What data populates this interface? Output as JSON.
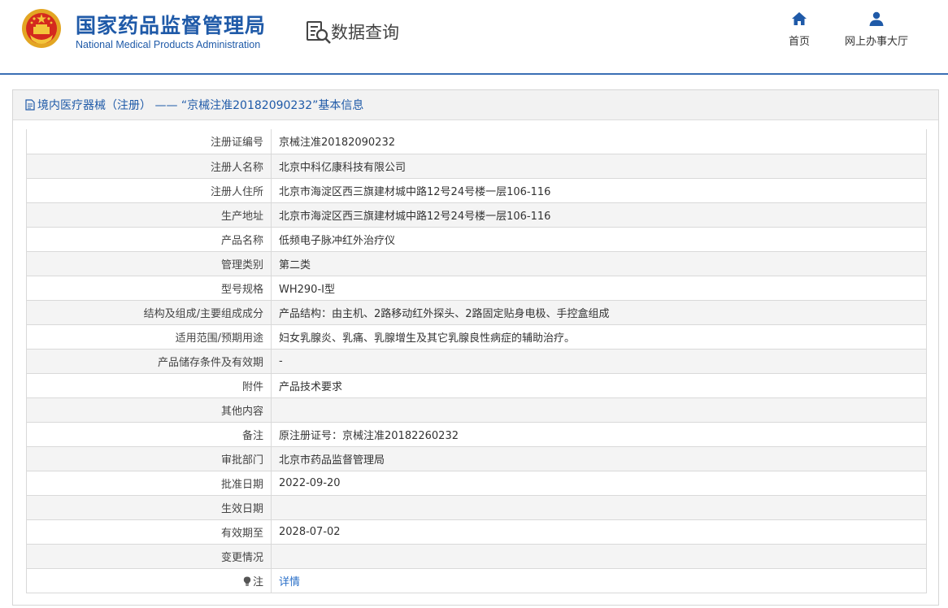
{
  "header": {
    "agency_cn": "国家药品监督管理局",
    "agency_en": "National Medical Products Administration",
    "query_title": "数据查询",
    "nav": [
      {
        "label": "首页",
        "icon": "home-icon"
      },
      {
        "label": "网上办事大厅",
        "icon": "user-icon"
      }
    ]
  },
  "panel": {
    "title": "境内医疗器械（注册） ——  “京械注准20182090232”基本信息"
  },
  "rows": [
    {
      "label": "注册证编号",
      "value": "京械注准20182090232"
    },
    {
      "label": "注册人名称",
      "value": "北京中科亿康科技有限公司"
    },
    {
      "label": "注册人住所",
      "value": "北京市海淀区西三旗建材城中路12号24号楼一层106-116"
    },
    {
      "label": "生产地址",
      "value": "北京市海淀区西三旗建材城中路12号24号楼一层106-116"
    },
    {
      "label": "产品名称",
      "value": "低频电子脉冲红外治疗仪"
    },
    {
      "label": "管理类别",
      "value": "第二类"
    },
    {
      "label": "型号规格",
      "value": "WH290-I型"
    },
    {
      "label": "结构及组成/主要组成成分",
      "value": "产品结构：由主机、2路移动红外探头、2路固定贴身电极、手控盒组成"
    },
    {
      "label": "适用范围/预期用途",
      "value": "妇女乳腺炎、乳痛、乳腺增生及其它乳腺良性病症的辅助治疗。"
    },
    {
      "label": "产品储存条件及有效期",
      "value": "-"
    },
    {
      "label": "附件",
      "value": "产品技术要求"
    },
    {
      "label": "其他内容",
      "value": ""
    },
    {
      "label": "备注",
      "value": "原注册证号：京械注准20182260232"
    },
    {
      "label": "审批部门",
      "value": "北京市药品监督管理局"
    },
    {
      "label": "批准日期",
      "value": "2022-09-20"
    },
    {
      "label": "生效日期",
      "value": ""
    },
    {
      "label": "有效期至",
      "value": "2028-07-02"
    },
    {
      "label": "变更情况",
      "value": ""
    }
  ],
  "note_row": {
    "label": "注",
    "value": "详情",
    "icon": "lightbulb-icon"
  },
  "colors": {
    "brand_blue": "#1f5aa8",
    "link_blue": "#2a6fc8",
    "row_alt": "#f4f4f4"
  }
}
